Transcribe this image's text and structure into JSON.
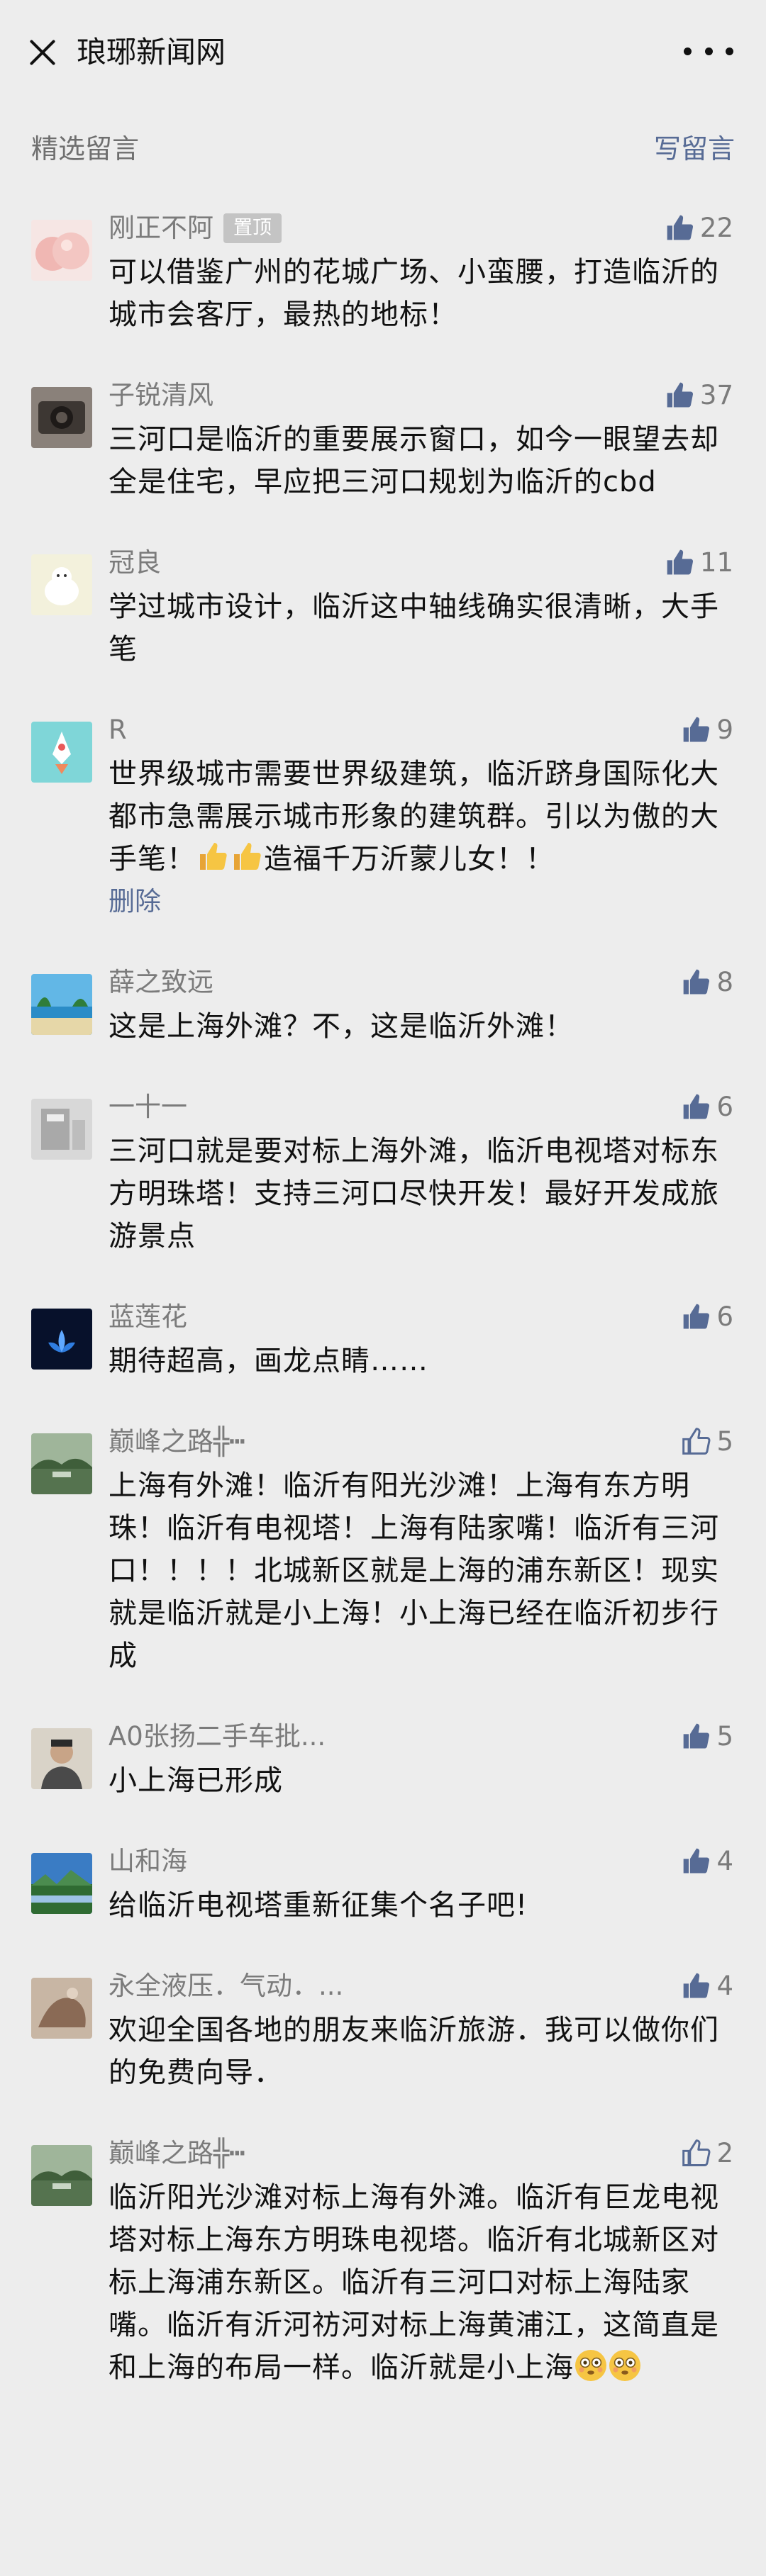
{
  "header": {
    "title": "琅琊新闻网"
  },
  "section": {
    "title": "精选留言",
    "write_label": "写留言"
  },
  "comments": [
    {
      "nick": "刚正不阿",
      "pinned": "置顶",
      "likes": "22",
      "text": "可以借鉴广州的花城广场、小蛮腰，打造临沂的城市会客厅，最热的地标！",
      "avatar_color": "#f3c7c4"
    },
    {
      "nick": "子锐清风",
      "likes": "37",
      "text": "三河口是临沂的重要展示窗口，如今一眼望去却全是住宅，早应把三河口规划为临沂的cbd",
      "avatar_color": "#6b625c"
    },
    {
      "nick": "冠良",
      "likes": "11",
      "text": "学过城市设计，临沂这中轴线确实很清晰，大手笔",
      "avatar_color": "#e8e6cf"
    },
    {
      "nick": "R",
      "likes": "9",
      "text_a": "世界级城市需要世界级建筑，临沂跻身国际化大都市急需展示城市形象的建筑群。引以为傲的大手笔！",
      "text_b": "造福千万沂蒙儿女！！",
      "delete_label": "删除",
      "avatar_color": "#7fd6d8"
    },
    {
      "nick": "薛之致远",
      "likes": "8",
      "text": "这是上海外滩？不，这是临沂外滩！",
      "avatar_color": "#3a9ad1"
    },
    {
      "nick": "一十一",
      "likes": "6",
      "text": "三河口就是要对标上海外滩，临沂电视塔对标东方明珠塔！支持三河口尽快开发！最好开发成旅游景点",
      "avatar_color": "#cfcfcf"
    },
    {
      "nick": "蓝莲花",
      "likes": "6",
      "text": "期待超高，画龙点睛……",
      "avatar_color": "#0b1a3a"
    },
    {
      "nick": "巅峰之路╬┅",
      "likes": "5",
      "text": "上海有外滩！临沂有阳光沙滩！上海有东方明珠！临沂有电视塔！上海有陆家嘴！临沂有三河口！！！！北城新区就是上海的浦东新区！现实就是临沂就是小上海！小上海已经在临沂初步行成",
      "avatar_color": "#6f8f6a"
    },
    {
      "nick": "A0张扬二手车批...",
      "likes": "5",
      "text": "小上海已形成",
      "avatar_color": "#b9b0a2"
    },
    {
      "nick": "山和海",
      "likes": "4",
      "text": "给临沂电视塔重新征集个名子吧!",
      "avatar_color": "#3e79b8"
    },
    {
      "nick": "永全液压．气动．...",
      "likes": "4",
      "text": "欢迎全国各地的朋友来临沂旅游．我可以做你们的免费向导．",
      "avatar_color": "#8a6a55"
    },
    {
      "nick": "巅峰之路╬┅",
      "likes": "2",
      "text_a": "临沂阳光沙滩对标上海有外滩。临沂有巨龙电视塔对标上海东方明珠电视塔。临沂有北城新区对标上海浦东新区。临沂有三河口对标上海陆家嘴。临沂有沂河祊河对标上海黄浦江，这简直是和上海的布局一样。临沂就是小上海",
      "avatar_color": "#6f8f6a"
    }
  ],
  "colors": {
    "link": "#576b95",
    "meta": "#7b7b7b",
    "background": "#ededed"
  },
  "icons": {
    "like_filled": "thumbs-up-filled-icon",
    "like_outline": "thumbs-up-outline-icon",
    "close": "close-icon",
    "more": "more-icon"
  }
}
